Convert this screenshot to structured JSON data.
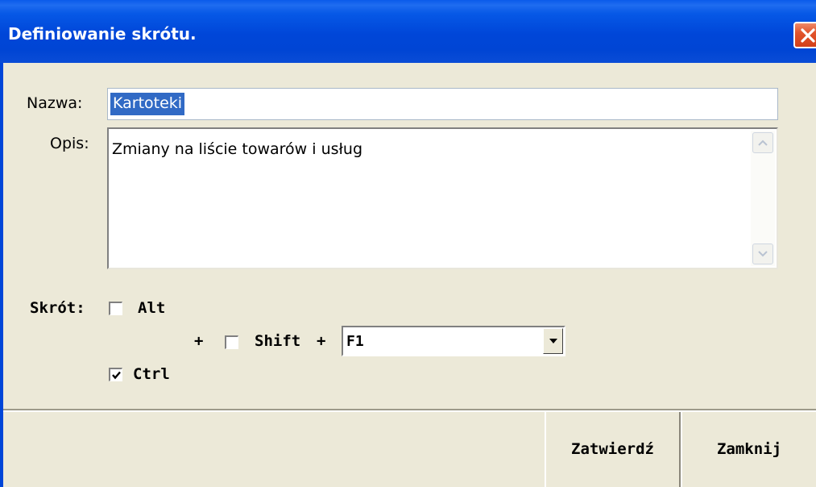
{
  "window": {
    "title": "Definiowanie skrótu.",
    "close_icon": "close-icon"
  },
  "form": {
    "name_label": "Nazwa:",
    "name_value": "Kartoteki",
    "desc_label": "Opis:",
    "desc_value": "Zmiany na liście towarów i usług",
    "shortcut_label": "Skrót:",
    "alt_label": "Alt",
    "alt_checked": false,
    "shift_label": "Shift",
    "shift_checked": false,
    "ctrl_label": "Ctrl",
    "ctrl_checked": true,
    "plus1": "+",
    "plus2": "+",
    "key_value": "F1"
  },
  "buttons": {
    "confirm_label": "Zatwierdź",
    "close_label": "Zamknij"
  },
  "colors": {
    "titlebar": "#0046d8",
    "face": "#ece9d8",
    "selection": "#316ac5",
    "close_button": "#e2542c"
  }
}
